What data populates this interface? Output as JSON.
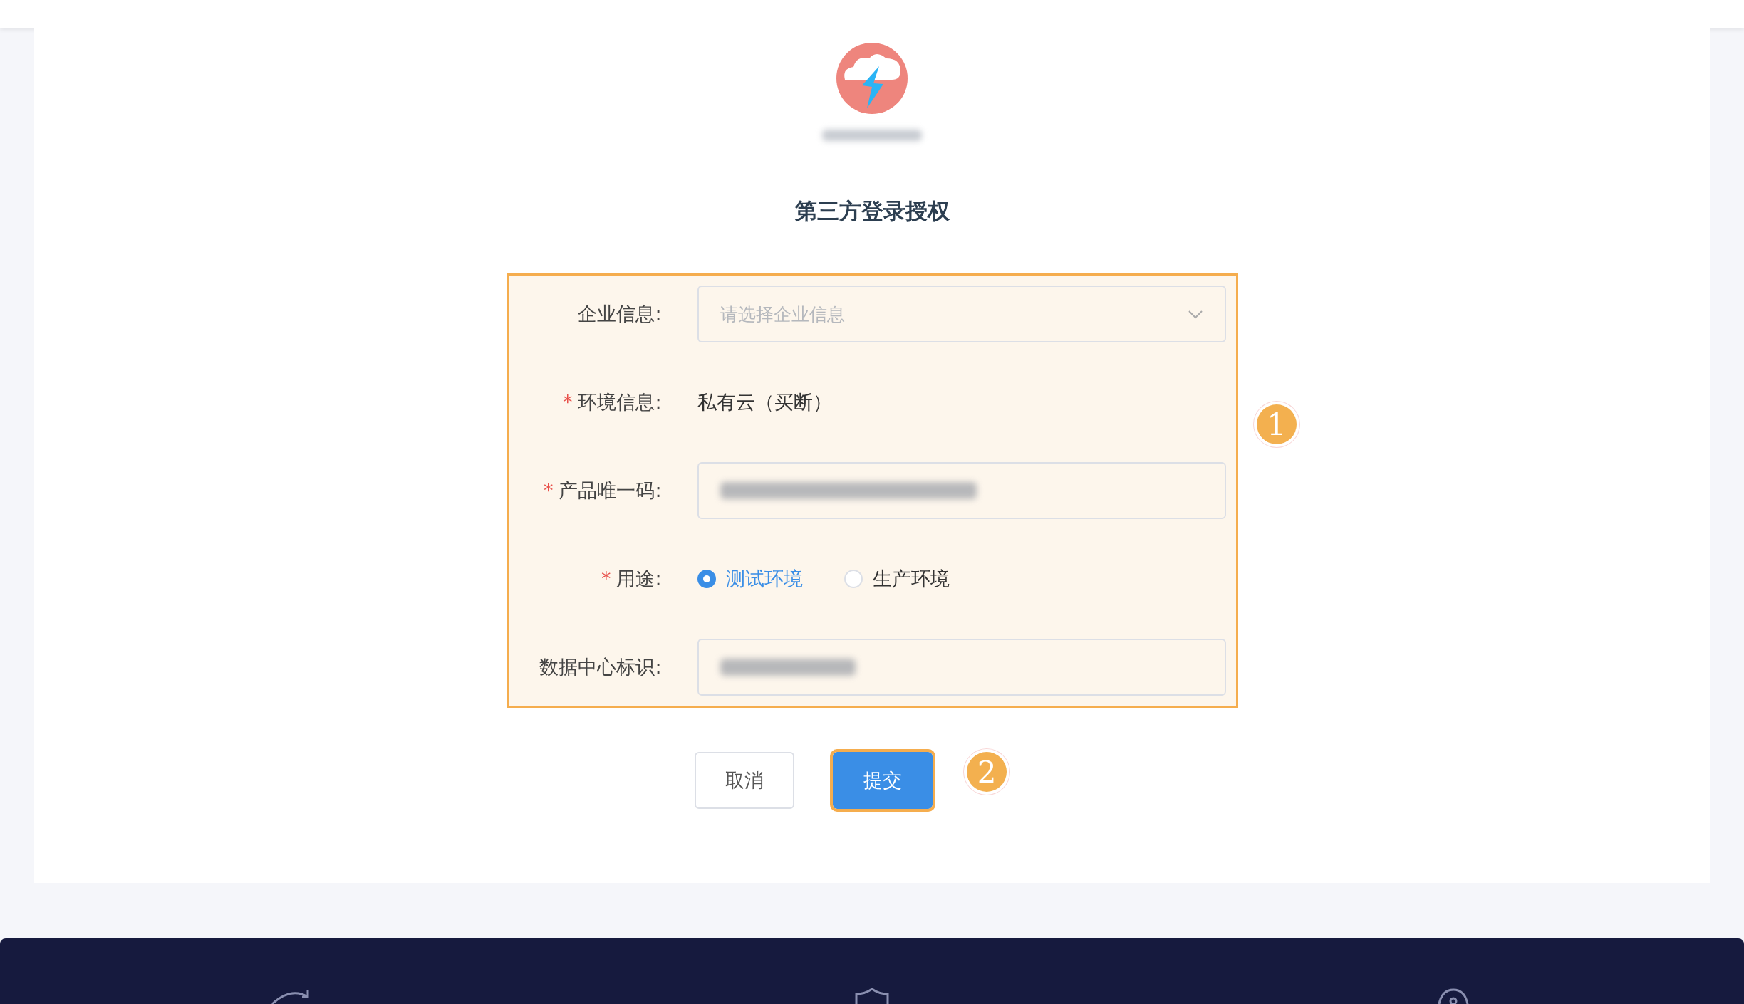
{
  "account": {
    "redacted": true
  },
  "title": "第三方登录授权",
  "form": {
    "highlighted": true,
    "marker": "1",
    "fields": [
      {
        "kind": "select",
        "label": "企业信息:",
        "placeholder": "请选择企业信息"
      },
      {
        "kind": "text",
        "label": "环境信息:",
        "required_mark": "*",
        "value": "私有云（买断）"
      },
      {
        "kind": "input",
        "label": "产品唯一码:",
        "required_mark": "*",
        "redacted": true
      },
      {
        "kind": "radio",
        "label": "用途:",
        "required_mark": "*",
        "options": [
          {
            "label": "测试环境",
            "selected": true
          },
          {
            "label": "生产环境",
            "selected": false
          }
        ]
      },
      {
        "kind": "input",
        "label": "数据中心标识:",
        "redacted": true
      }
    ]
  },
  "buttons": [
    {
      "label": "取消",
      "kind": "default",
      "highlighted": false
    },
    {
      "label": "提交",
      "kind": "primary",
      "highlighted": true,
      "marker": "2"
    }
  ]
}
